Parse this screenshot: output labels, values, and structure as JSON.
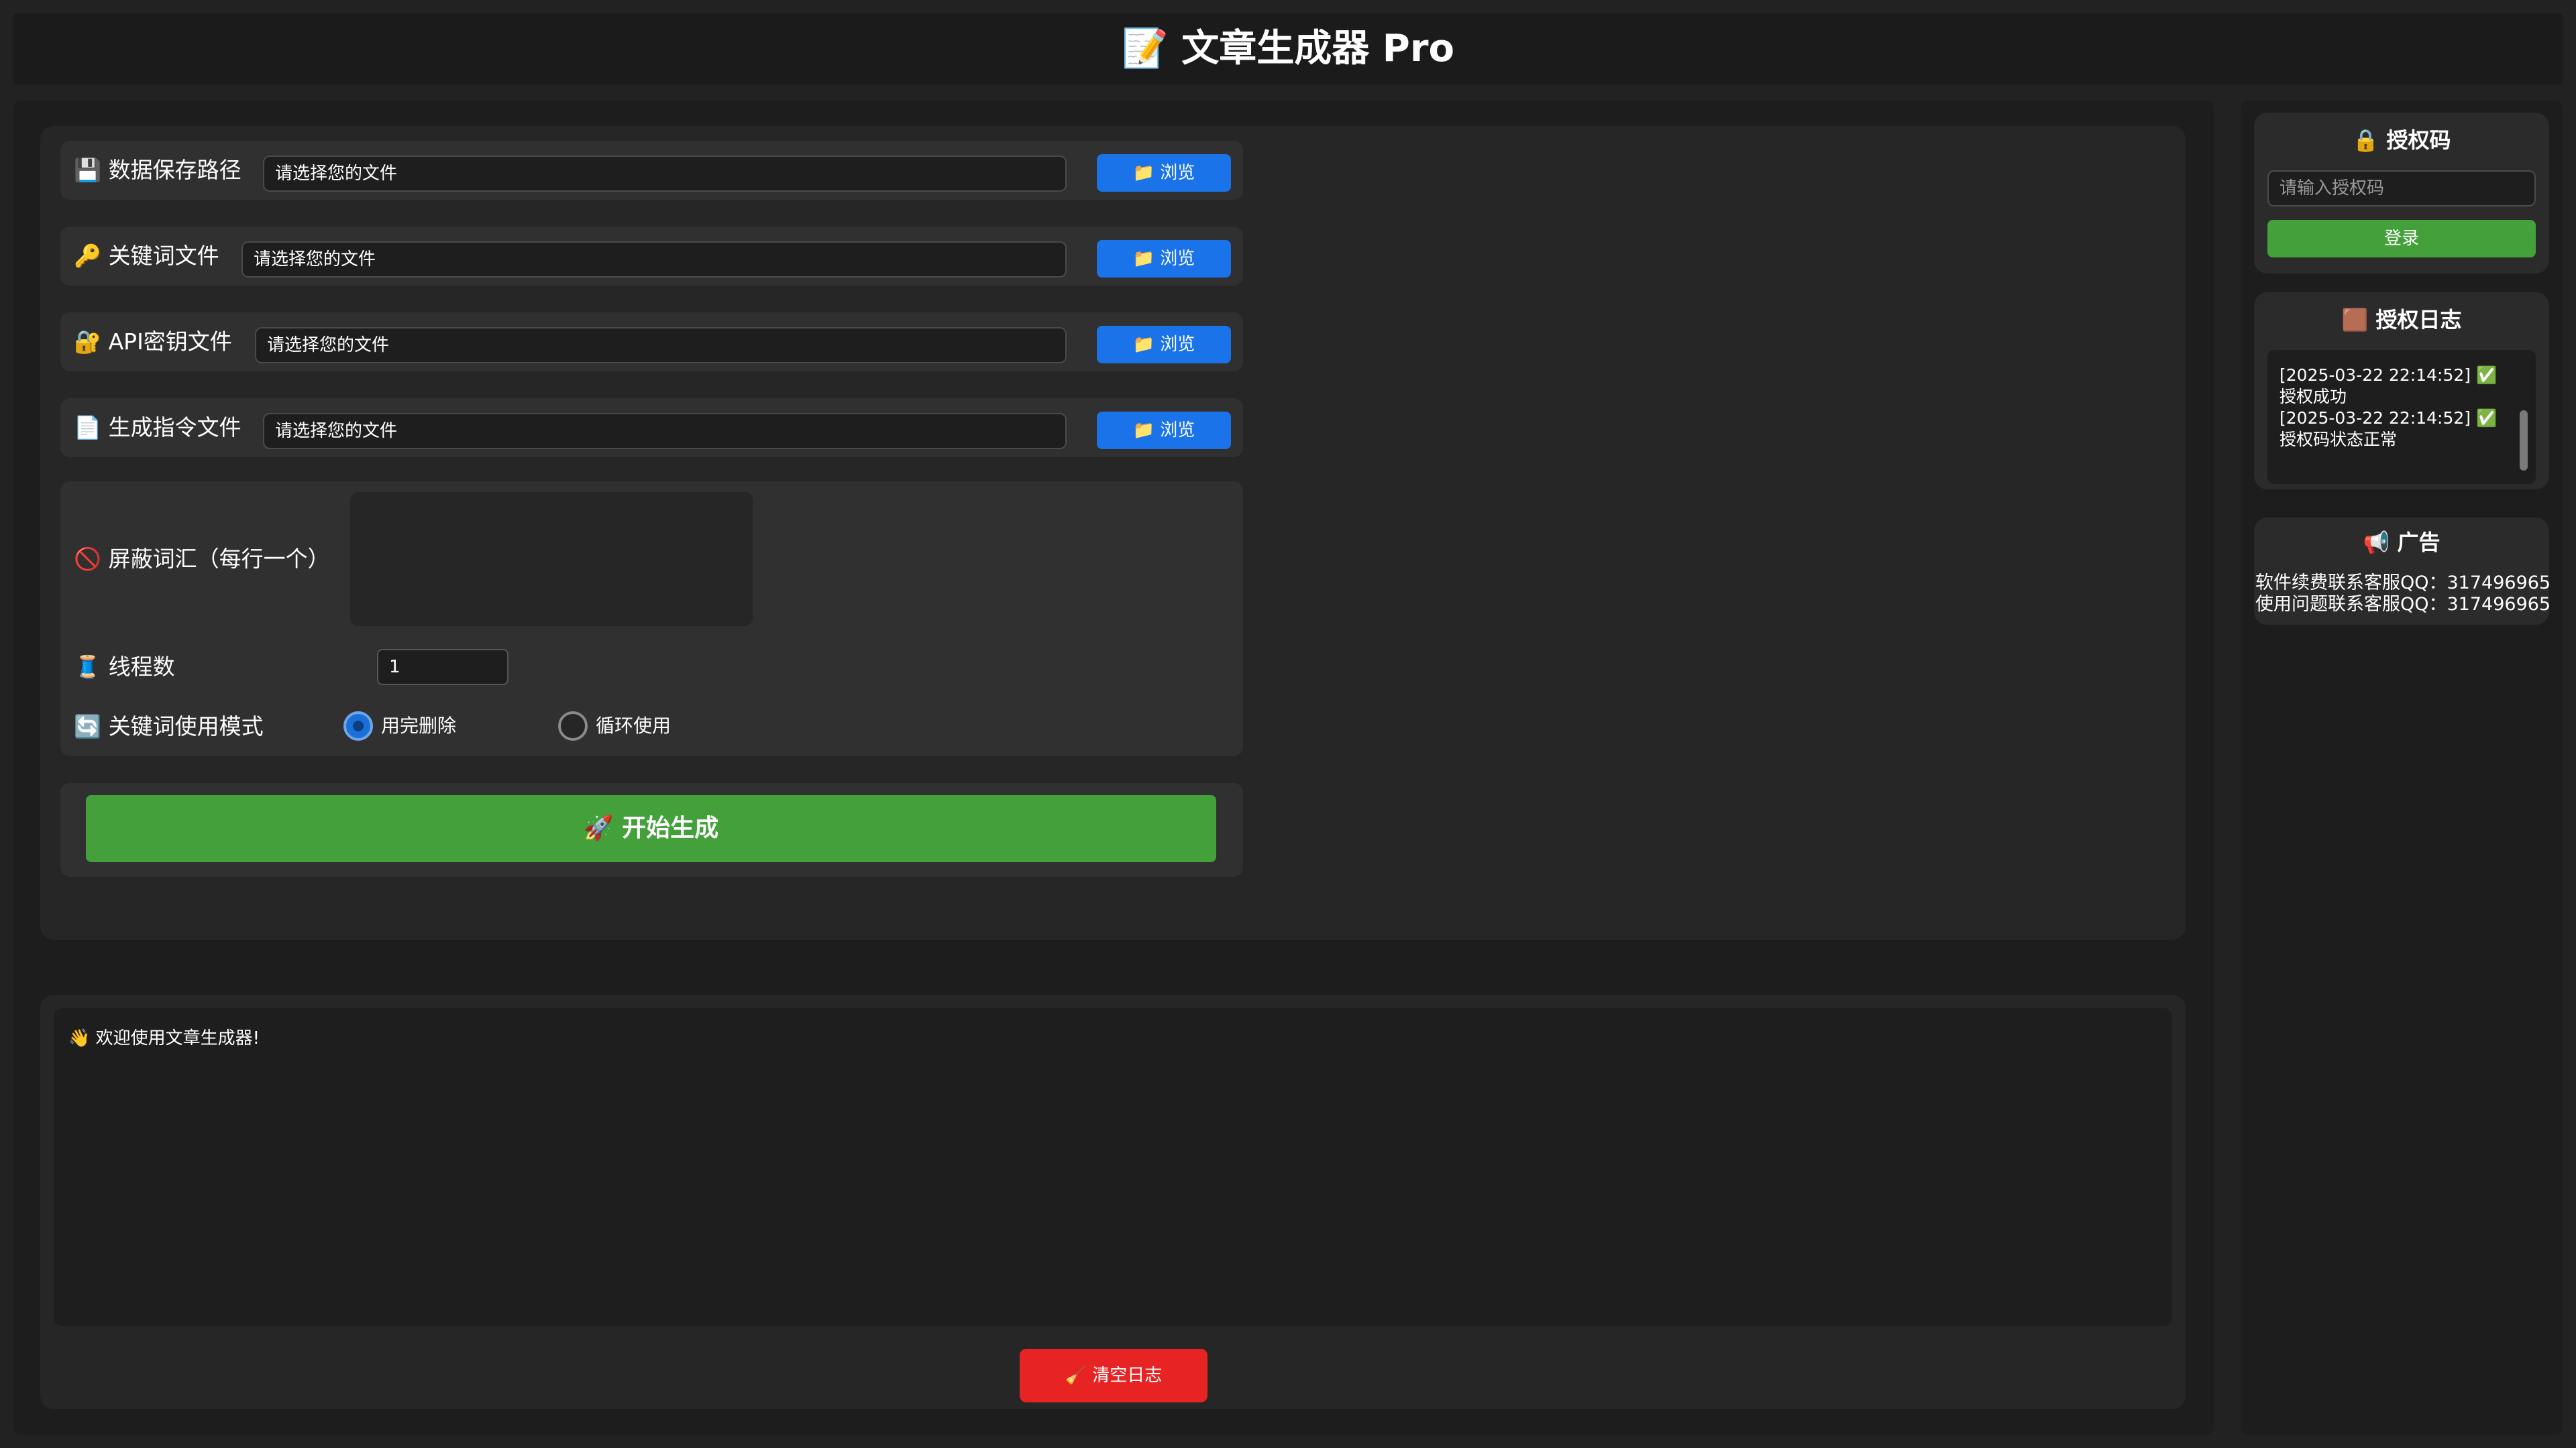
{
  "header": {
    "title": "📝 文章生成器 Pro"
  },
  "file_rows": [
    {
      "icon": "💾",
      "label": "数据保存路径",
      "placeholder": "请选择您的文件",
      "button": "📁 浏览"
    },
    {
      "icon": "🔑",
      "label": "关键词文件",
      "placeholder": "请选择您的文件",
      "button": "📁 浏览"
    },
    {
      "icon": "🔐",
      "label": "API密钥文件",
      "placeholder": "请选择您的文件",
      "button": "📁 浏览"
    },
    {
      "icon": "📄",
      "label": "生成指令文件",
      "placeholder": "请选择您的文件",
      "button": "📁 浏览"
    }
  ],
  "settings": {
    "blocked_words": {
      "icon": "🚫",
      "label": "屏蔽词汇（每行一个）",
      "value": ""
    },
    "threads": {
      "icon": "🧵",
      "label": "线程数",
      "value": "1"
    },
    "keyword_mode": {
      "icon": "🔄",
      "label": "关键词使用模式",
      "options": [
        "用完删除",
        "循环使用"
      ],
      "selected": "用完删除"
    }
  },
  "start_button": "🚀 开始生成",
  "log": {
    "lines": [
      "👋 欢迎使用文章生成器!"
    ],
    "clear_button": "🧹 清空日志"
  },
  "sidebar": {
    "auth": {
      "title": "🔒 授权码",
      "placeholder": "请输入授权码",
      "login_button": "登录"
    },
    "auth_log": {
      "title": "🟫 授权日志",
      "lines": [
        "[2025-03-22 22:14:52] ✅",
        "授权成功",
        "[2025-03-22 22:14:52] ✅",
        "授权码状态正常"
      ]
    },
    "ads": {
      "title": "📢 广告",
      "lines": [
        "软件续费联系客服QQ：317496965",
        "使用问题联系客服QQ：317496965"
      ]
    }
  },
  "colors": {
    "background": "#222222",
    "panel": "#262626",
    "primary_blue": "#1a73e8",
    "success_green": "#43a03a",
    "danger_red": "#e82323"
  }
}
